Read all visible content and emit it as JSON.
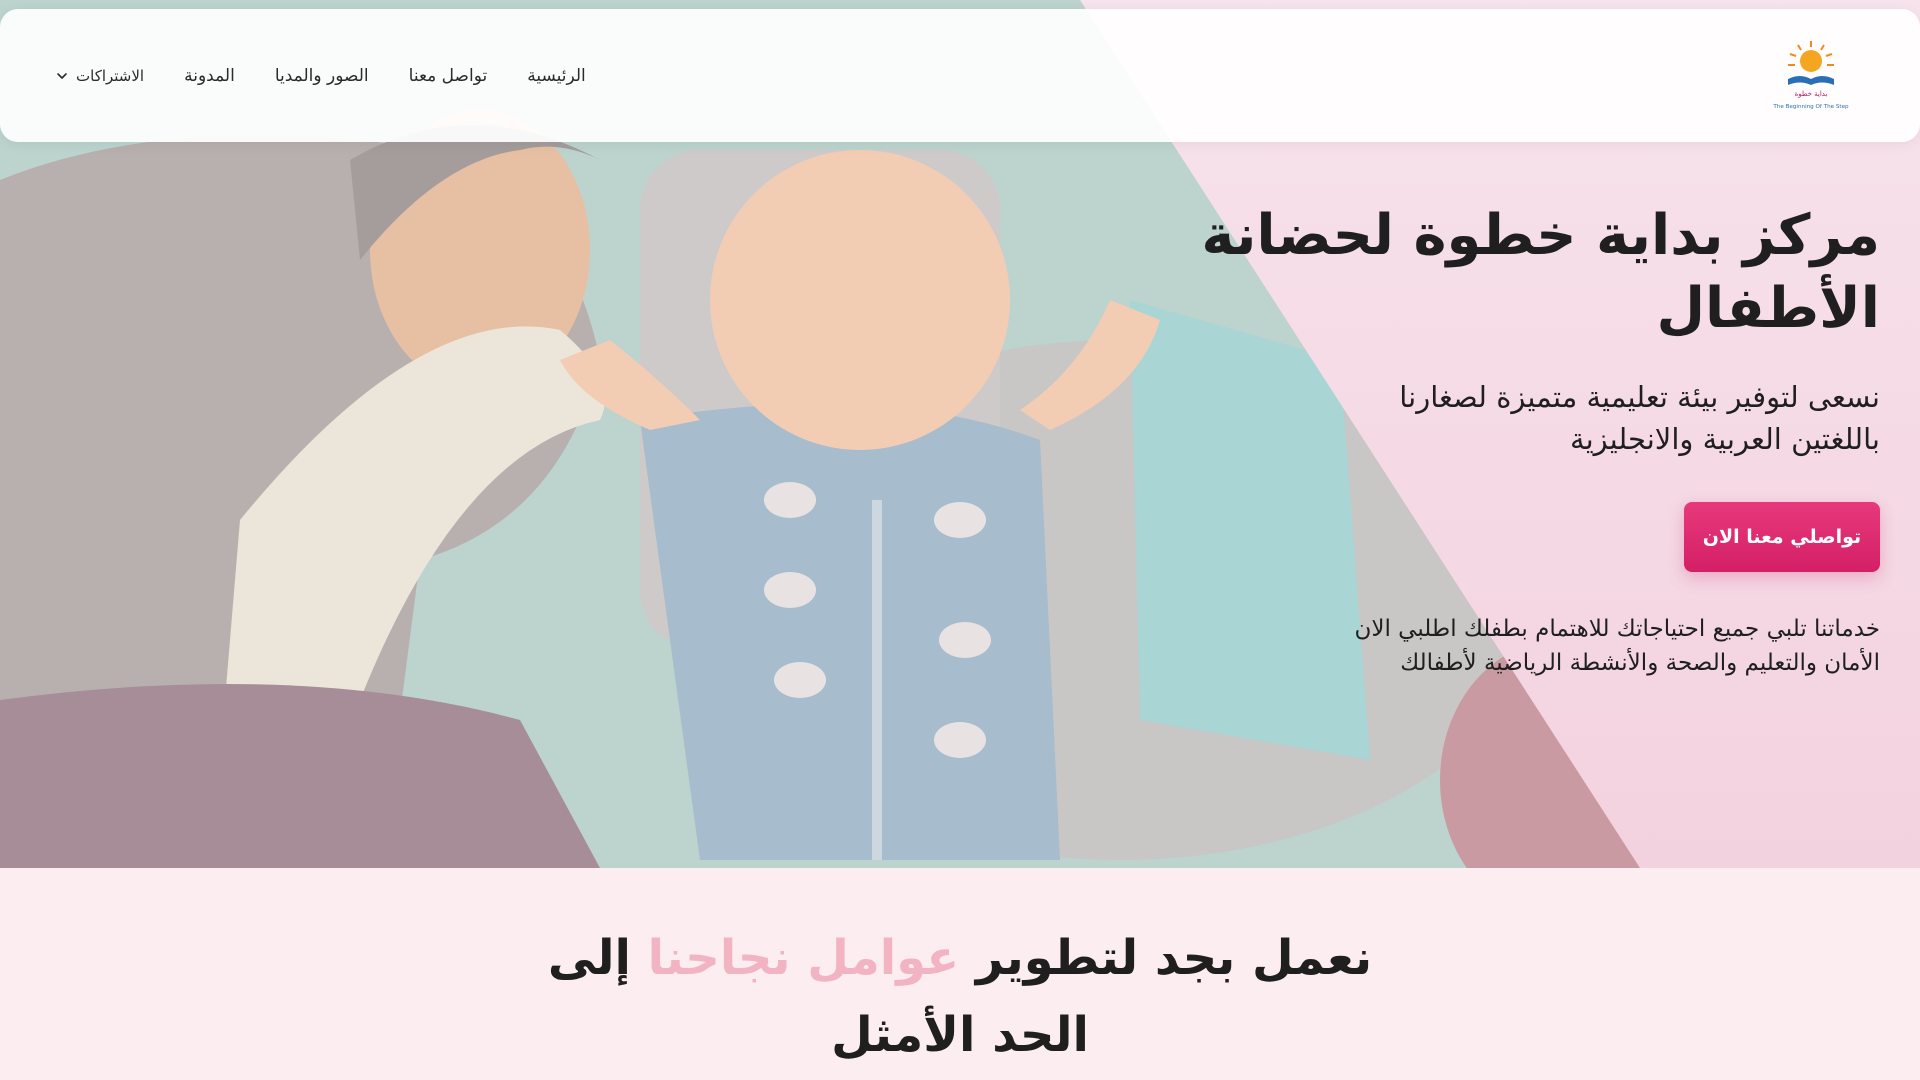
{
  "nav": {
    "logo_caption": "The Beginning Of The Step",
    "logo_arabic": "بداية خطوة",
    "items": [
      {
        "label": "الرئيسية"
      },
      {
        "label": "تواصل معنا"
      },
      {
        "label": "الصور والمديا"
      },
      {
        "label": "المدونة"
      }
    ],
    "dropdown_label": "الاشتراكات",
    "dropdown_icon": "chevron-down-icon"
  },
  "hero": {
    "title": "مركز بداية خطوة لحضانة الأطفال",
    "subtitle": "نسعى لتوفير بيئة تعليمية متميزة لصغارنا باللغتين العربية والانجليزية",
    "cta_label": "تواصلي معنا الان",
    "description": "خدماتنا تلبي جميع احتياجاتك للاهتمام بطفلك اطلبي الان الأمان والتعليم والصحة والأنشطة الرياضية لأطفالك"
  },
  "section": {
    "heading_part1": "نعمل بجد لتطوير",
    "heading_accent": "عوامل نجاحنا",
    "heading_part2": "إلى الحد الأمثل"
  },
  "colors": {
    "accent_pink": "#e0296f",
    "heading_accent": "#f2b3c2",
    "section_bg": "#fcedf0",
    "hero_panel": "#f5dbe6"
  }
}
